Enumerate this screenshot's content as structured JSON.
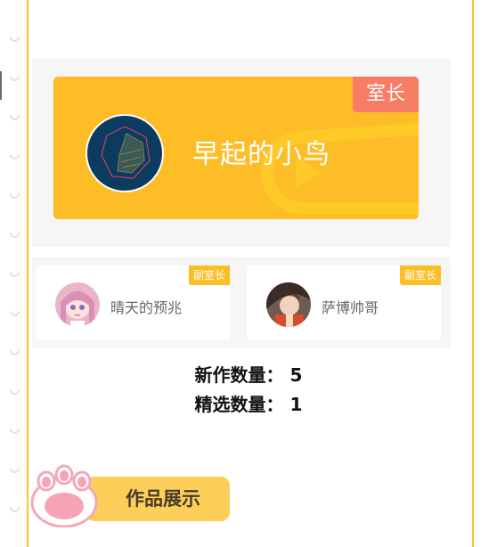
{
  "owner": {
    "name": "早起的小鸟",
    "role": "室长"
  },
  "vice_owners": [
    {
      "name": "晴天的预兆",
      "role": "副室长"
    },
    {
      "name": "萨博帅哥",
      "role": "副室长"
    }
  ],
  "stats": {
    "new_works": "新作数量：  5",
    "featured": "精选数量：  1"
  },
  "works_button": {
    "label": "作品展示"
  },
  "colors": {
    "accent_yellow": "#fdbd27",
    "owner_badge": "#f67c63",
    "card_border": "#f5c530",
    "panel_bg": "#f6f6f6"
  }
}
